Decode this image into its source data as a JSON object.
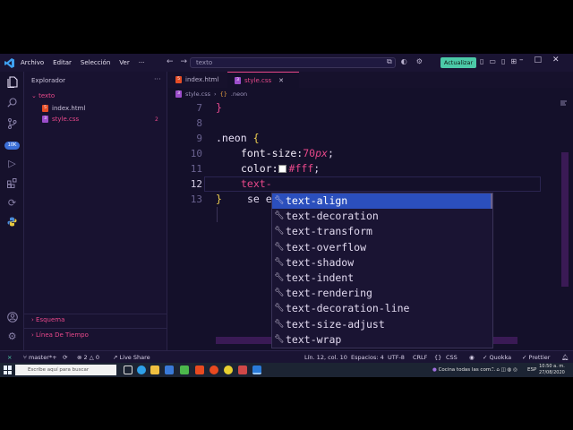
{
  "titlebar": {
    "menu": [
      "Archivo",
      "Editar",
      "Selección",
      "Ver"
    ],
    "command_center": "texto",
    "update_label": "Actualizar"
  },
  "activity_badge": "10K",
  "sidebar": {
    "title": "Explorador",
    "folder": "texto",
    "files": [
      {
        "name": "index.html",
        "icon": "html-file-icon",
        "color": "#e44d26",
        "count": ""
      },
      {
        "name": "style.css",
        "icon": "css-file-icon",
        "color": "#9b4dca",
        "count": "2"
      }
    ],
    "sections": [
      "Esquema",
      "Línea De Tiempo"
    ]
  },
  "tabs": [
    {
      "label": "index.html",
      "active": false
    },
    {
      "label": "style.css",
      "active": true
    }
  ],
  "breadcrumbs": {
    "file": "style.css",
    "symbol": ".neon"
  },
  "editor": {
    "lines": [
      {
        "number": "7",
        "code": "}"
      },
      {
        "number": "8",
        "code": ""
      },
      {
        "number": "9",
        "selector": ".neon",
        "brace": "{"
      },
      {
        "number": "10",
        "prop": "font-size:",
        "num": "70",
        "unit": "px",
        "end": ";"
      },
      {
        "number": "11",
        "prop": "color:",
        "value": "#fff",
        "end": ";"
      },
      {
        "number": "12",
        "partial": "text-"
      },
      {
        "number": "13",
        "brace": "}",
        "ghost": "se e"
      }
    ]
  },
  "suggest": {
    "items": [
      "text-align",
      "text-decoration",
      "text-transform",
      "text-overflow",
      "text-shadow",
      "text-indent",
      "text-rendering",
      "text-decoration-line",
      "text-size-adjust",
      "text-wrap"
    ],
    "selected_index": 0
  },
  "statusbar": {
    "branch": "master*+",
    "errors": "2",
    "warnings": "0",
    "live_share": "Live Share",
    "position": "Lín. 12, col. 10",
    "spaces": "Espacios: 4",
    "encoding": "UTF-8",
    "eol": "CRLF",
    "language": "CSS",
    "quokka": "Quokka",
    "prettier": "Prettier"
  },
  "taskbar": {
    "search_placeholder": "Escribe aquí para buscar",
    "notification": "Cocina todas las com...",
    "lang": "ESP",
    "time": "10:50 a. m.",
    "date": "27/08/2020"
  },
  "colors": {
    "accent": "#e8488a",
    "selection": "#2b4fbd",
    "update": "#4cc9a8"
  }
}
